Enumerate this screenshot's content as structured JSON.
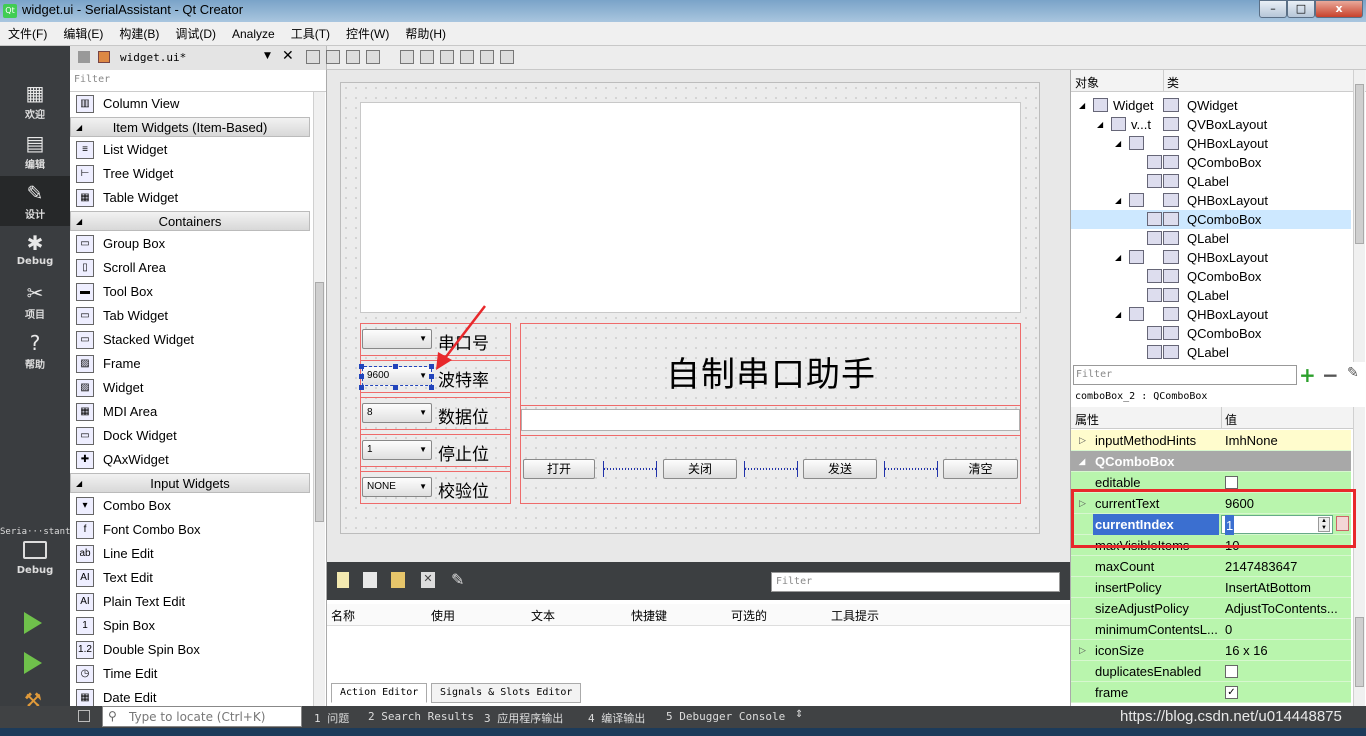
{
  "window": {
    "title": "widget.ui - SerialAssistant - Qt Creator",
    "min": "–",
    "max": "□",
    "close": "x"
  },
  "menu": [
    "文件(F)",
    "编辑(E)",
    "构建(B)",
    "调试(D)",
    "Analyze",
    "工具(T)",
    "控件(W)",
    "帮助(H)"
  ],
  "modes": [
    {
      "label": "欢迎",
      "icon": "▦"
    },
    {
      "label": "编辑",
      "icon": "▤"
    },
    {
      "label": "设计",
      "icon": "✎"
    },
    {
      "label": "Debug",
      "icon": "✱"
    },
    {
      "label": "项目",
      "icon": "✂"
    },
    {
      "label": "帮助",
      "icon": "?"
    }
  ],
  "run_target": {
    "project": "Seria···stant",
    "config": "Debug"
  },
  "doc": {
    "file": "widget.ui*"
  },
  "widgetbox": {
    "filter_placeholder": "Filter",
    "items": [
      {
        "kind": "item",
        "label": "Column View",
        "icon": "▥"
      },
      {
        "kind": "cat",
        "label": "Item Widgets (Item-Based)"
      },
      {
        "kind": "item",
        "label": "List Widget",
        "icon": "≡"
      },
      {
        "kind": "item",
        "label": "Tree Widget",
        "icon": "⊢"
      },
      {
        "kind": "item",
        "label": "Table Widget",
        "icon": "▦"
      },
      {
        "kind": "cat",
        "label": "Containers"
      },
      {
        "kind": "item",
        "label": "Group Box",
        "icon": "▭"
      },
      {
        "kind": "item",
        "label": "Scroll Area",
        "icon": "▯"
      },
      {
        "kind": "item",
        "label": "Tool Box",
        "icon": "▬"
      },
      {
        "kind": "item",
        "label": "Tab Widget",
        "icon": "▭"
      },
      {
        "kind": "item",
        "label": "Stacked Widget",
        "icon": "▭"
      },
      {
        "kind": "item",
        "label": "Frame",
        "icon": "▨"
      },
      {
        "kind": "item",
        "label": "Widget",
        "icon": "▨"
      },
      {
        "kind": "item",
        "label": "MDI Area",
        "icon": "▦"
      },
      {
        "kind": "item",
        "label": "Dock Widget",
        "icon": "▭"
      },
      {
        "kind": "item",
        "label": "QAxWidget",
        "icon": "✚"
      },
      {
        "kind": "cat",
        "label": "Input Widgets"
      },
      {
        "kind": "item",
        "label": "Combo Box",
        "icon": "▾"
      },
      {
        "kind": "item",
        "label": "Font Combo Box",
        "icon": "f"
      },
      {
        "kind": "item",
        "label": "Line Edit",
        "icon": "ab"
      },
      {
        "kind": "item",
        "label": "Text Edit",
        "icon": "AI"
      },
      {
        "kind": "item",
        "label": "Plain Text Edit",
        "icon": "AI"
      },
      {
        "kind": "item",
        "label": "Spin Box",
        "icon": "1"
      },
      {
        "kind": "item",
        "label": "Double Spin Box",
        "icon": "1.2"
      },
      {
        "kind": "item",
        "label": "Time Edit",
        "icon": "◷"
      },
      {
        "kind": "item",
        "label": "Date Edit",
        "icon": "▦"
      }
    ]
  },
  "form": {
    "title": "自制串口助手",
    "rows": [
      {
        "combo": "",
        "label": "串口号"
      },
      {
        "combo": "9600",
        "label": "波特率"
      },
      {
        "combo": "8",
        "label": "数据位"
      },
      {
        "combo": "1",
        "label": "停止位"
      },
      {
        "combo": "NONE",
        "label": "校验位"
      }
    ],
    "buttons": [
      "打开",
      "关闭",
      "发送",
      "清空"
    ]
  },
  "action_editor": {
    "filter_placeholder": "Filter",
    "columns": [
      "名称",
      "使用",
      "文本",
      "快捷键",
      "可选的",
      "工具提示"
    ],
    "tabs": [
      "Action Editor",
      "Signals & Slots Editor"
    ]
  },
  "object_inspector": {
    "headers": [
      "对象",
      "类"
    ],
    "rows": [
      {
        "obj": "Widget",
        "cls": "QWidget",
        "indent": 0,
        "exp": "◢"
      },
      {
        "obj": "v...t",
        "cls": "QVBoxLayout",
        "indent": 1,
        "exp": "◢"
      },
      {
        "obj": "",
        "cls": "QHBoxLayout",
        "indent": 2,
        "exp": "◢"
      },
      {
        "obj": "",
        "cls": "QComboBox",
        "indent": 3,
        "exp": ""
      },
      {
        "obj": "",
        "cls": "QLabel",
        "indent": 3,
        "exp": ""
      },
      {
        "obj": "",
        "cls": "QHBoxLayout",
        "indent": 2,
        "exp": "◢"
      },
      {
        "obj": "",
        "cls": "QComboBox",
        "indent": 3,
        "exp": "",
        "selected": true
      },
      {
        "obj": "",
        "cls": "QLabel",
        "indent": 3,
        "exp": ""
      },
      {
        "obj": "",
        "cls": "QHBoxLayout",
        "indent": 2,
        "exp": "◢"
      },
      {
        "obj": "",
        "cls": "QComboBox",
        "indent": 3,
        "exp": ""
      },
      {
        "obj": "",
        "cls": "QLabel",
        "indent": 3,
        "exp": ""
      },
      {
        "obj": "",
        "cls": "QHBoxLayout",
        "indent": 2,
        "exp": "◢"
      },
      {
        "obj": "",
        "cls": "QComboBox",
        "indent": 3,
        "exp": ""
      },
      {
        "obj": "",
        "cls": "QLabel",
        "indent": 3,
        "exp": ""
      }
    ]
  },
  "property_editor": {
    "filter_placeholder": "Filter",
    "object_label": "comboBox_2 : QComboBox",
    "headers": [
      "属性",
      "值"
    ],
    "section": "QComboBox",
    "rows": [
      {
        "name": "inputMethodHints",
        "value": "ImhNone",
        "style": "yel",
        "exp": "▷"
      },
      {
        "name": "editable",
        "value": "",
        "check": false
      },
      {
        "name": "currentText",
        "value": "9600",
        "exp": "▷"
      },
      {
        "name": "currentIndex",
        "value": "1",
        "editing": true
      },
      {
        "name": "maxVisibleItems",
        "value": "10"
      },
      {
        "name": "maxCount",
        "value": "2147483647"
      },
      {
        "name": "insertPolicy",
        "value": "InsertAtBottom"
      },
      {
        "name": "sizeAdjustPolicy",
        "value": "AdjustToContents..."
      },
      {
        "name": "minimumContentsL...",
        "value": "0"
      },
      {
        "name": "iconSize",
        "value": "16 x 16",
        "exp": "▷"
      },
      {
        "name": "duplicatesEnabled",
        "value": "",
        "check": false
      },
      {
        "name": "frame",
        "value": "",
        "check": true
      }
    ]
  },
  "statusbar": {
    "locate_placeholder": "Type to locate (Ctrl+K)",
    "panes": [
      "1 问题",
      "2 Search Results",
      "3 应用程序输出",
      "4 编译输出",
      "5 Debugger Console"
    ],
    "watermark": "https://blog.csdn.net/u014448875"
  },
  "colors": {
    "highlight_box": "#e8282b",
    "prop_green": "#b9f5ad",
    "prop_yellow": "#fffccd",
    "selected_row": "#cde8ff",
    "arrow": "#e8282b"
  }
}
